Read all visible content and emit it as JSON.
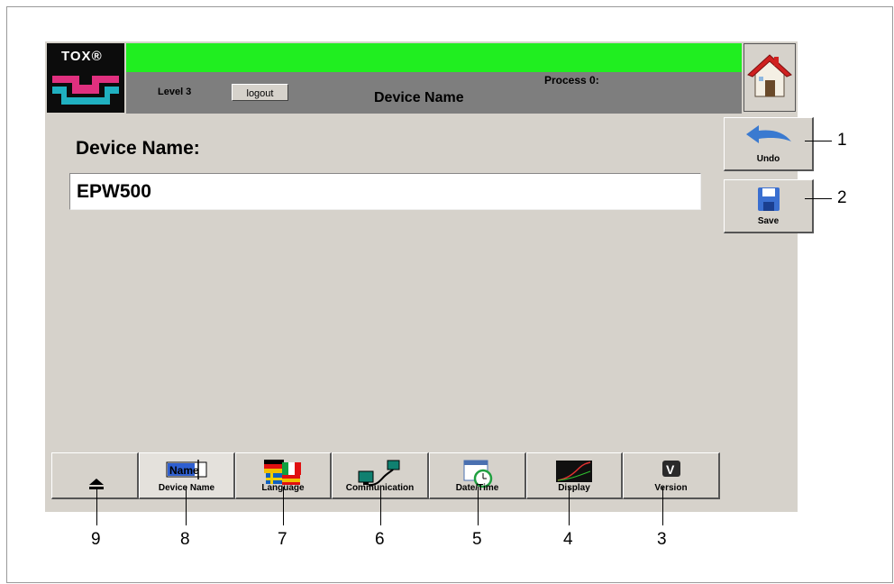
{
  "header": {
    "logo_text": "TOX®",
    "level": "Level 3",
    "logout_label": "logout",
    "process": "Process 0:",
    "title": "Device Name"
  },
  "home": {
    "icon": "home-icon"
  },
  "sidebar": {
    "undo_label": "Undo",
    "save_label": "Save"
  },
  "content": {
    "heading": "Device Name:",
    "device_name_value": "EPW500"
  },
  "tabs": [
    {
      "label": "",
      "icon": "eject-icon"
    },
    {
      "label": "Device Name",
      "icon": "name-icon",
      "icon_text": "Name",
      "active": true
    },
    {
      "label": "Language",
      "icon": "flags-icon"
    },
    {
      "label": "Communication",
      "icon": "network-icon"
    },
    {
      "label": "Date/Time",
      "icon": "calendar-clock-icon"
    },
    {
      "label": "Display",
      "icon": "display-icon"
    },
    {
      "label": "Version",
      "icon": "version-icon",
      "icon_text": "V"
    }
  ],
  "callouts": [
    "1",
    "2",
    "3",
    "4",
    "5",
    "6",
    "7",
    "8",
    "9"
  ],
  "colors": {
    "screen_bg": "#d6d2cb",
    "status_green": "#20ee20",
    "header_gray": "#7e7e7e",
    "logo_bg": "#0c0c0c",
    "logo_magenta": "#e0307f",
    "logo_cyan": "#20b0c0"
  }
}
